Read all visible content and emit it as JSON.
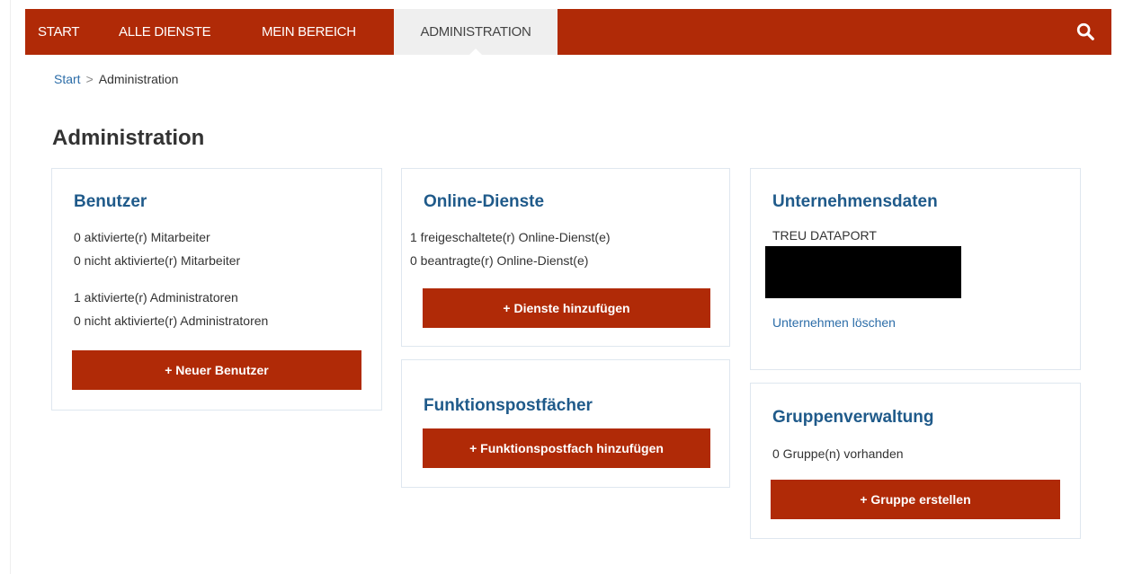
{
  "nav": {
    "items": [
      {
        "label": "START"
      },
      {
        "label": "ALLE DIENSTE"
      },
      {
        "label": "MEIN BEREICH"
      },
      {
        "label": "ADMINISTRATION"
      }
    ],
    "active_index": 3,
    "search_icon": "search-icon"
  },
  "breadcrumb": {
    "home": "Start",
    "separator": ">",
    "current": "Administration"
  },
  "page": {
    "title": "Administration"
  },
  "benutzer": {
    "title": "Benutzer",
    "lines": [
      "0 aktivierte(r) Mitarbeiter",
      "0 nicht aktivierte(r) Mitarbeiter",
      "1 aktivierte(r) Administratoren",
      "0 nicht aktivierte(r) Administratoren"
    ],
    "button": "+ Neuer Benutzer"
  },
  "online_dienste": {
    "title": "Online-Dienste",
    "lines": [
      "1 freigeschaltete(r) Online-Dienst(e)",
      "0 beantragte(r) Online-Dienst(e)"
    ],
    "button": "+ Dienste hinzufügen"
  },
  "funktionspostfaecher": {
    "title": "Funktionspostfächer",
    "button": "+ Funktionspostfach hinzufügen"
  },
  "unternehmensdaten": {
    "title": "Unternehmensdaten",
    "company": "TREU DATAPORT",
    "link": "Unternehmen löschen"
  },
  "gruppenverwaltung": {
    "title": "Gruppenverwaltung",
    "line": "0 Gruppe(n) vorhanden",
    "button": "+ Gruppe erstellen"
  },
  "colors": {
    "brand": "#b02a07",
    "title_blue": "#1f5a8a",
    "link_blue": "#2c6da8"
  }
}
